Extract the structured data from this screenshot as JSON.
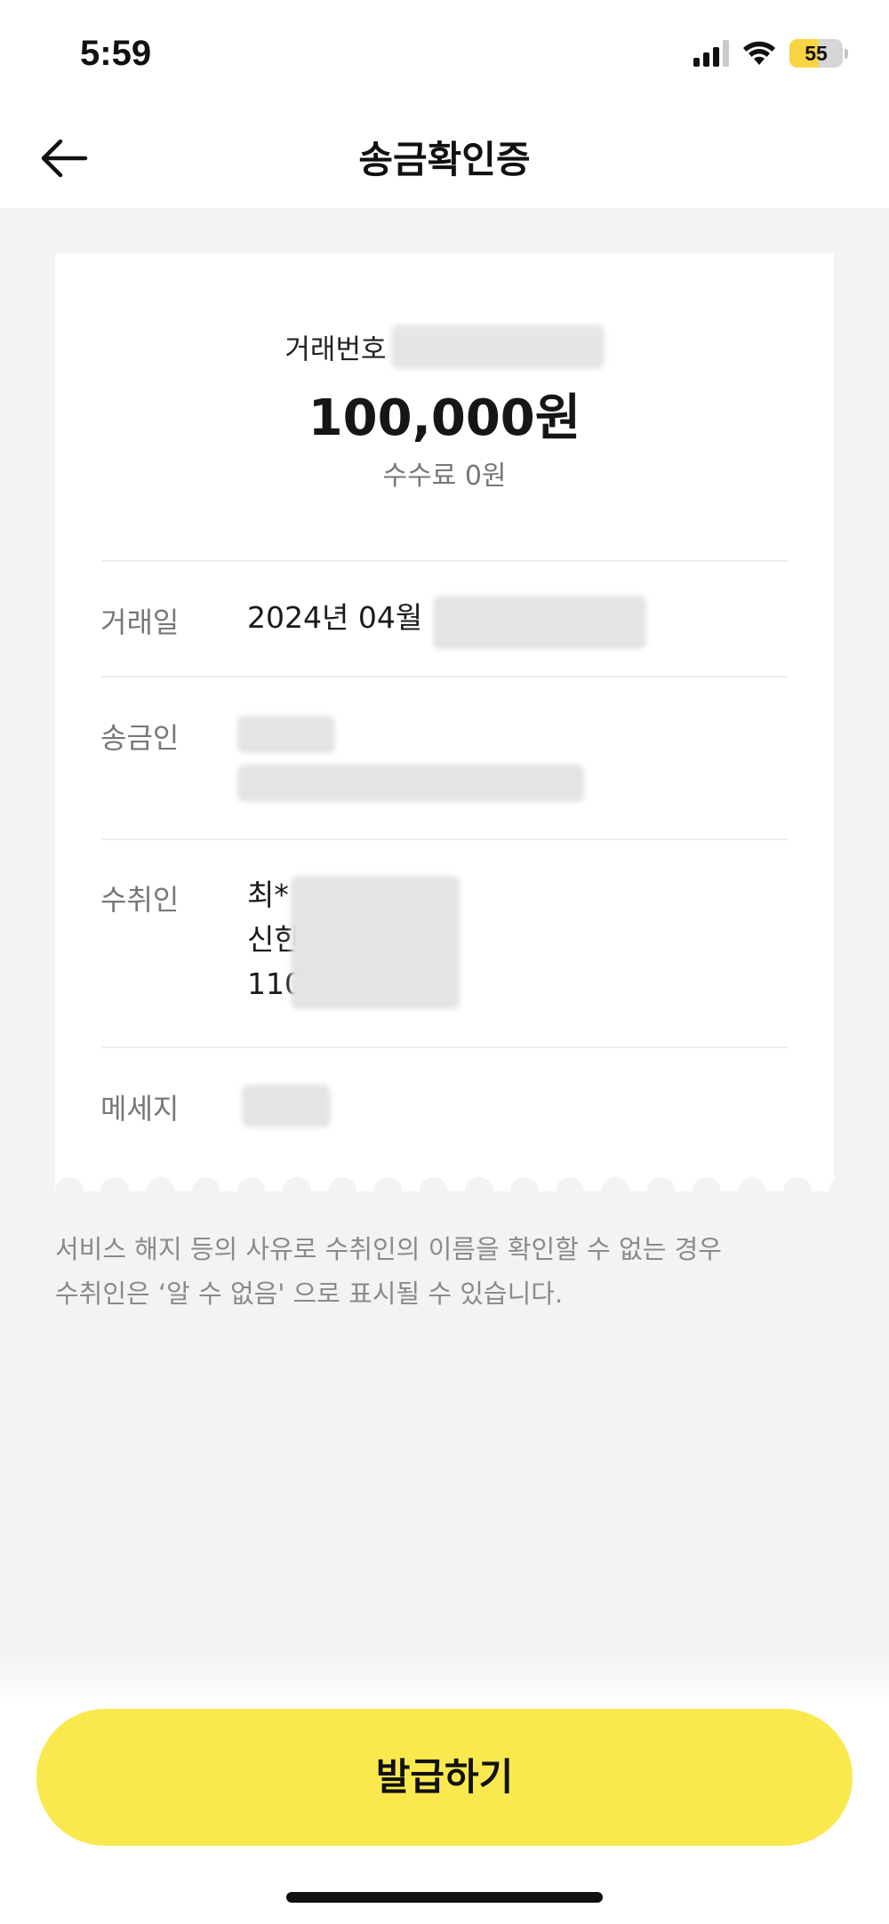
{
  "status_bar": {
    "time": "5:59",
    "battery_level": "55",
    "battery_fraction": 0.55
  },
  "nav": {
    "title": "송금확인증",
    "back_icon": "arrow-left-icon"
  },
  "receipt": {
    "txn_label": "거래번호",
    "amount": "100,000원",
    "fee": "수수료 0원",
    "date_label": "거래일",
    "date_value": "2024년 04월",
    "sender_label": "송금인",
    "recipient_label": "수취인",
    "recipient_name": "최*",
    "recipient_bank": "신한",
    "recipient_account": "110",
    "message_label": "메세지"
  },
  "notice": {
    "line1": "서비스 해지 등의 사유로 수취인의 이름을 확인할 수 없는 경우",
    "line2": "수취인은 ‘알 수 없음' 으로 표시될 수 있습니다."
  },
  "actions": {
    "issue_label": "발급하기"
  },
  "colors": {
    "accent": "#fae94e",
    "background": "#f2f3f3",
    "card": "#ffffff"
  }
}
